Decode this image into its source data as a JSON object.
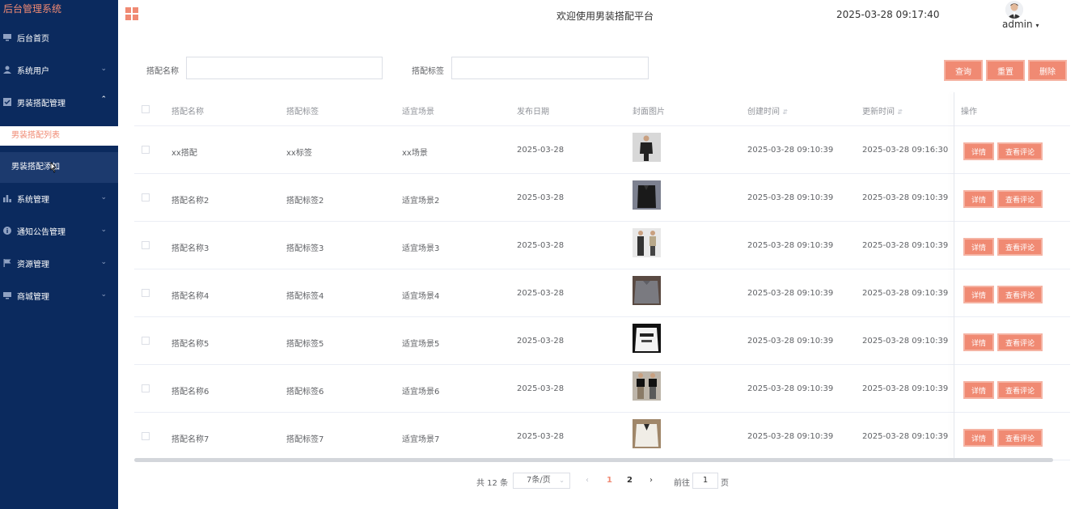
{
  "sidebar": {
    "brand": "后台管理系统",
    "items": [
      {
        "label": "后台首页",
        "icon": "monitor-icon"
      },
      {
        "label": "系统用户",
        "icon": "user-icon"
      },
      {
        "label": "男装搭配管理",
        "icon": "checkbox-icon"
      },
      {
        "label": "系统管理",
        "icon": "bar-chart-icon"
      },
      {
        "label": "通知公告管理",
        "icon": "info-icon"
      },
      {
        "label": "资源管理",
        "icon": "flag-icon"
      },
      {
        "label": "商城管理",
        "icon": "monitor-icon"
      }
    ],
    "submenu": {
      "active": "男装搭配列表",
      "hover": "男装搭配添加"
    }
  },
  "header": {
    "welcome": "欢迎使用男装搭配平台",
    "datetime": "2025-03-28 09:17:40",
    "username": "admin"
  },
  "search": {
    "name_label": "搭配名称",
    "tag_label": "搭配标签",
    "name_value": "",
    "tag_value": "",
    "query_label": "查询",
    "reset_label": "重置",
    "delete_label": "删除"
  },
  "table": {
    "headers": [
      "搭配名称",
      "搭配标签",
      "适宜场景",
      "发布日期",
      "封面图片",
      "创建时间",
      "更新时间",
      "操作"
    ],
    "rows": [
      {
        "name": "xx搭配",
        "tag": "xx标签",
        "scene": "xx场景",
        "date": "2025-03-28",
        "created": "2025-03-28 09:10:39",
        "updated": "2025-03-28 09:16:30"
      },
      {
        "name": "搭配名称2",
        "tag": "搭配标签2",
        "scene": "适宜场景2",
        "date": "2025-03-28",
        "created": "2025-03-28 09:10:39",
        "updated": "2025-03-28 09:10:39"
      },
      {
        "name": "搭配名称3",
        "tag": "搭配标签3",
        "scene": "适宜场景3",
        "date": "2025-03-28",
        "created": "2025-03-28 09:10:39",
        "updated": "2025-03-28 09:10:39"
      },
      {
        "name": "搭配名称4",
        "tag": "搭配标签4",
        "scene": "适宜场景4",
        "date": "2025-03-28",
        "created": "2025-03-28 09:10:39",
        "updated": "2025-03-28 09:10:39"
      },
      {
        "name": "搭配名称5",
        "tag": "搭配标签5",
        "scene": "适宜场景5",
        "date": "2025-03-28",
        "created": "2025-03-28 09:10:39",
        "updated": "2025-03-28 09:10:39"
      },
      {
        "name": "搭配名称6",
        "tag": "搭配标签6",
        "scene": "适宜场景6",
        "date": "2025-03-28",
        "created": "2025-03-28 09:10:39",
        "updated": "2025-03-28 09:10:39"
      },
      {
        "name": "搭配名称7",
        "tag": "搭配标签7",
        "scene": "适宜场景7",
        "date": "2025-03-28",
        "created": "2025-03-28 09:10:39",
        "updated": "2025-03-28 09:10:39"
      }
    ],
    "detail_label": "详情",
    "comments_label": "查看评论"
  },
  "pagination": {
    "total": "共 12 条",
    "page_size": "7条/页",
    "pages": [
      "1",
      "2"
    ],
    "current": "1",
    "goto_label": "前往",
    "goto_value": "1",
    "page_suffix": "页"
  },
  "colors": {
    "sidebar": "#0b2a5e",
    "accent": "#f08a73"
  }
}
